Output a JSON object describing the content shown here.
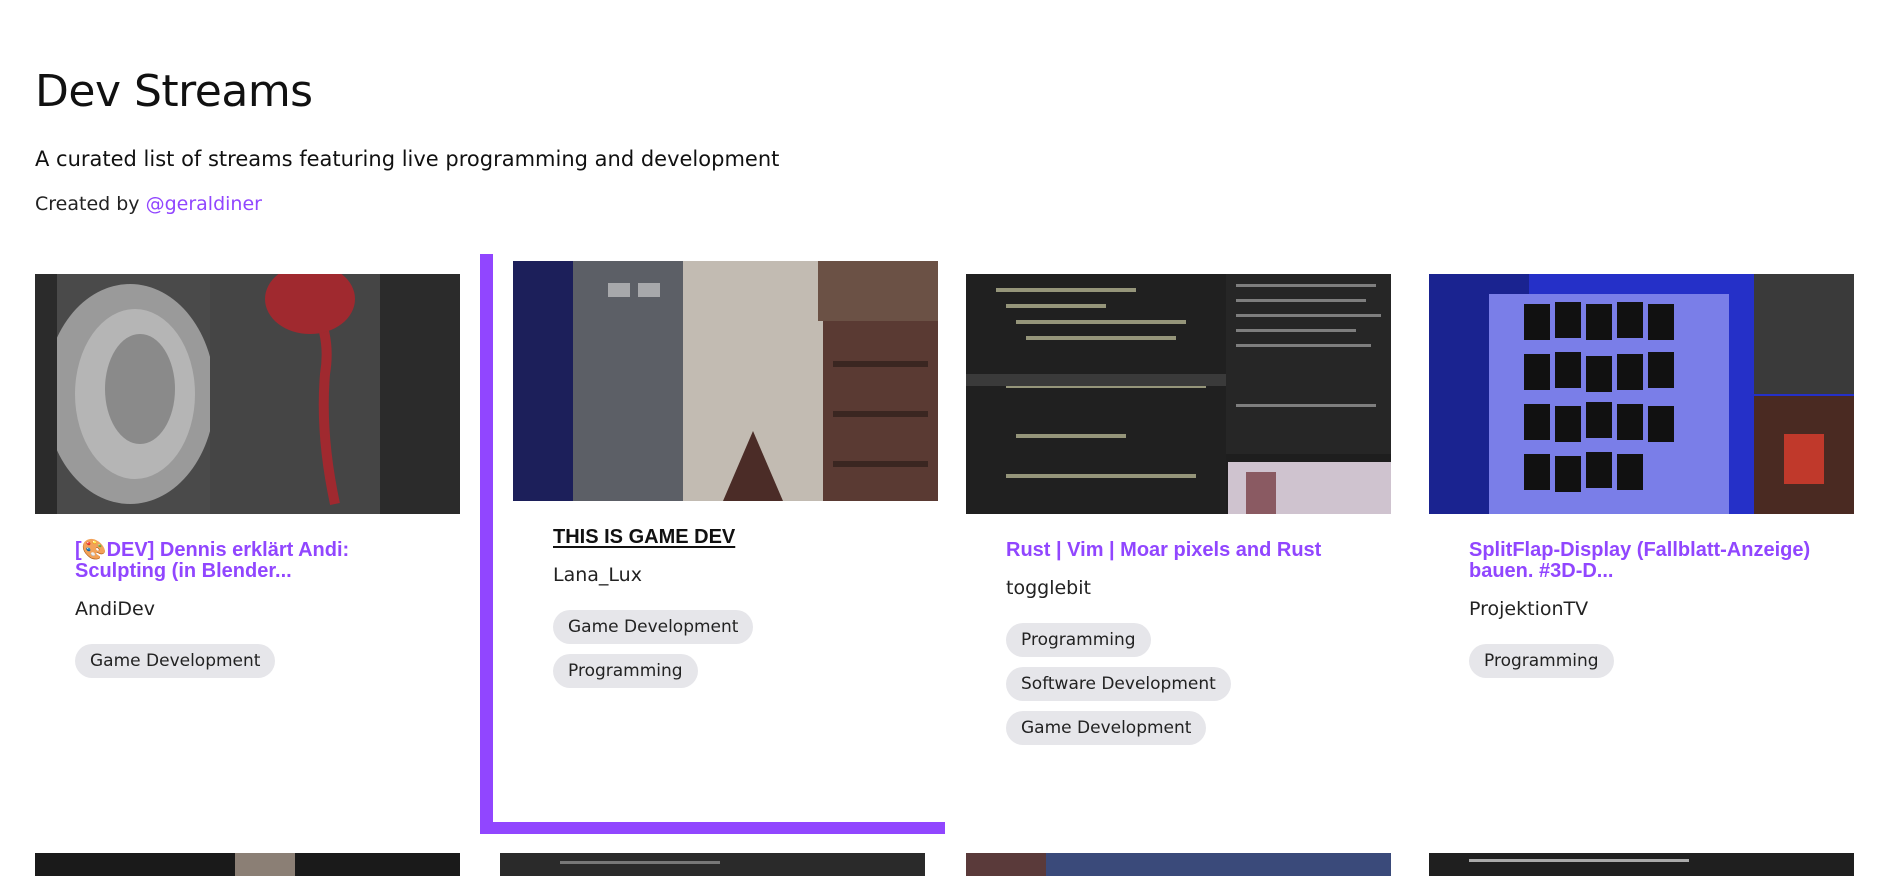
{
  "header": {
    "title": "Dev Streams",
    "subtitle": "A curated list of streams featuring live programming and development",
    "credit_prefix": "Created by",
    "credit_link": "@geraldiner"
  },
  "streams": [
    {
      "title": "[🎨DEV] Dennis erklärt Andi: Sculpting (in Blender...",
      "streamer": "AndiDev",
      "tags": [
        "Game Development"
      ]
    },
    {
      "title": "THIS IS GAME DEV",
      "streamer": "Lana_Lux",
      "tags": [
        "Game Development",
        "Programming"
      ]
    },
    {
      "title": "Rust | Vim | Moar pixels and Rust",
      "streamer": "togglebit",
      "tags": [
        "Programming",
        "Software Development",
        "Game Development"
      ]
    },
    {
      "title": "SplitFlap-Display (Fallblatt-Anzeige) bauen. #3D-D...",
      "streamer": "ProjektionTV",
      "tags": [
        "Programming"
      ]
    }
  ],
  "colors": {
    "accent": "#9146ff",
    "tag_bg": "#e6e6ea",
    "text": "#111111"
  }
}
